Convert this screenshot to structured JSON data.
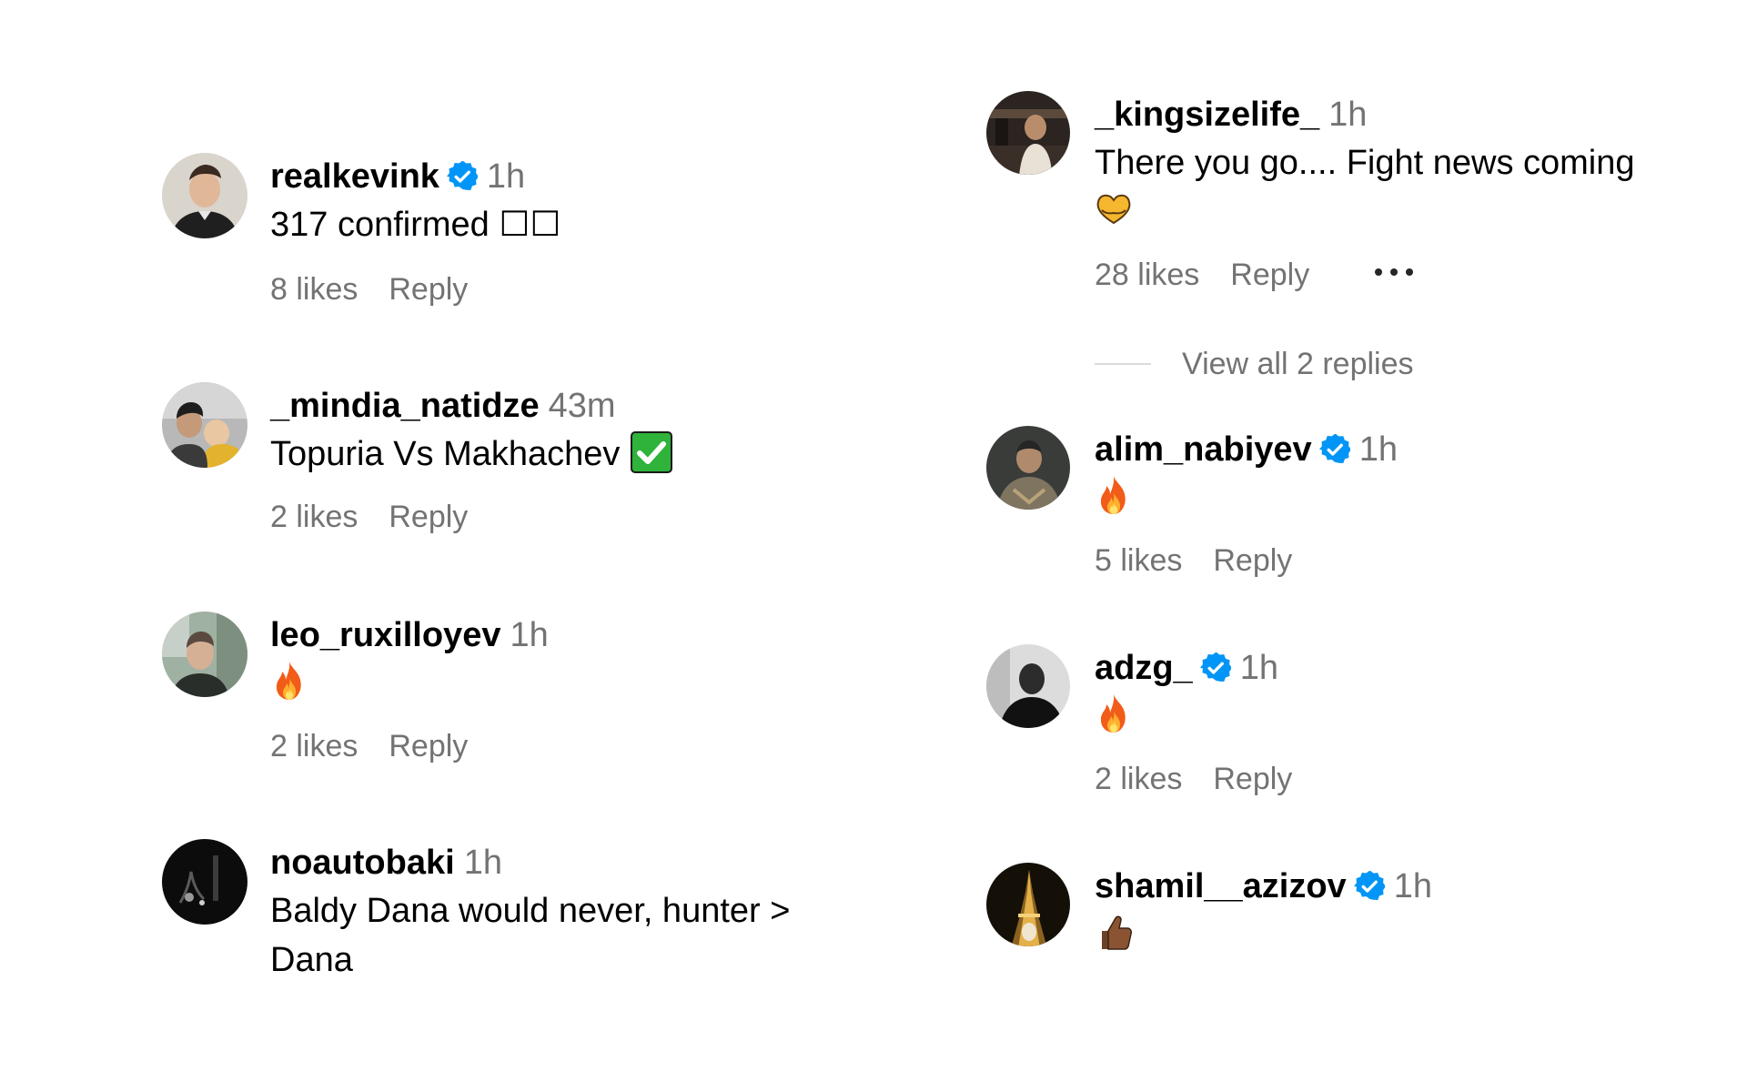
{
  "colors": {
    "secondary_text": "#737373",
    "verified_blue": "#0095F6",
    "divider": "#DBDBDB"
  },
  "left_comments": [
    {
      "username": "realkevink",
      "verified": true,
      "time": "1h",
      "text": "317 confirmed ☐☐",
      "likes": "8 likes",
      "reply": "Reply",
      "avatar_icon": "man-portrait-avatar"
    },
    {
      "username": "_mindia_natidze",
      "verified": false,
      "time": "43m",
      "text": "Topuria Vs Makhachev",
      "emoji": "check-mark-emoji",
      "likes": "2 likes",
      "reply": "Reply",
      "avatar_icon": "family-photo-avatar"
    },
    {
      "username": "leo_ruxilloyev",
      "verified": false,
      "time": "1h",
      "emoji": "fire-emoji",
      "likes": "2 likes",
      "reply": "Reply",
      "avatar_icon": "outdoor-portrait-avatar"
    },
    {
      "username": "noautobaki",
      "verified": false,
      "time": "1h",
      "text_line1": "Baldy Dana would never, hunter >",
      "text_line2": "Dana",
      "avatar_icon": "dark-photo-avatar"
    }
  ],
  "right_comments": [
    {
      "username": "_kingsizelife_",
      "verified": false,
      "time": "1h",
      "text": "There you go.... Fight news coming",
      "emoji": "heart-hands-emoji",
      "likes": "28 likes",
      "reply": "Reply",
      "more_icon": "more-options-icon",
      "view_replies": "View all 2 replies",
      "avatar_icon": "studio-photo-avatar"
    },
    {
      "username": "alim_nabiyev",
      "verified": true,
      "time": "1h",
      "emoji": "fire-emoji",
      "likes": "5 likes",
      "reply": "Reply",
      "avatar_icon": "fighter-portrait-avatar"
    },
    {
      "username": "adzg_",
      "verified": true,
      "time": "1h",
      "emoji": "fire-emoji",
      "likes": "2 likes",
      "reply": "Reply",
      "avatar_icon": "bw-portrait-avatar"
    },
    {
      "username": "shamil__azizov",
      "verified": true,
      "time": "1h",
      "emoji": "thumbs-up-emoji",
      "avatar_icon": "eiffel-tower-avatar"
    }
  ]
}
